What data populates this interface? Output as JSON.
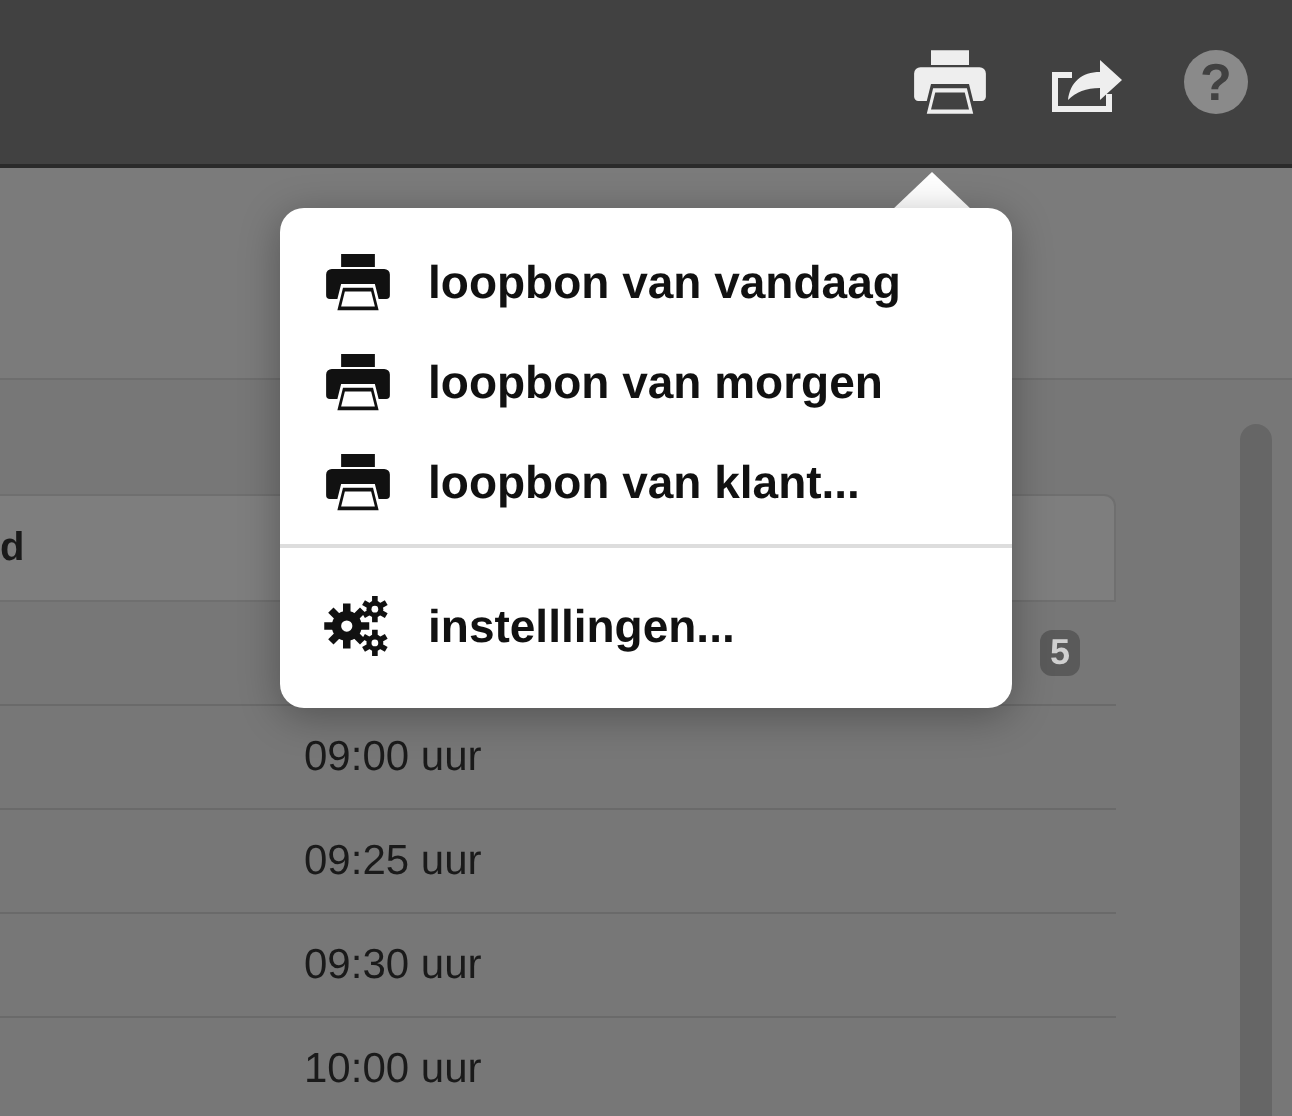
{
  "toolbar": {
    "buttons": [
      {
        "kind": "print"
      },
      {
        "kind": "share"
      },
      {
        "kind": "help",
        "label": "?"
      }
    ]
  },
  "table": {
    "columns": [
      {
        "label": "d"
      }
    ],
    "rows": [
      {
        "badge": "5"
      },
      {
        "column_2": "09:00 uur"
      },
      {
        "column_2": "09:25 uur"
      },
      {
        "column_2": "09:30 uur"
      },
      {
        "column_2": "10:00 uur"
      }
    ]
  },
  "print_menu": {
    "sections": [
      [
        {
          "kind": "print",
          "label": "loopbon van vandaag"
        },
        {
          "kind": "print",
          "label": "loopbon van morgen"
        },
        {
          "kind": "print",
          "label": "loopbon van klant..."
        }
      ],
      [
        {
          "kind": "settings",
          "label": "instelllingen..."
        }
      ]
    ]
  }
}
